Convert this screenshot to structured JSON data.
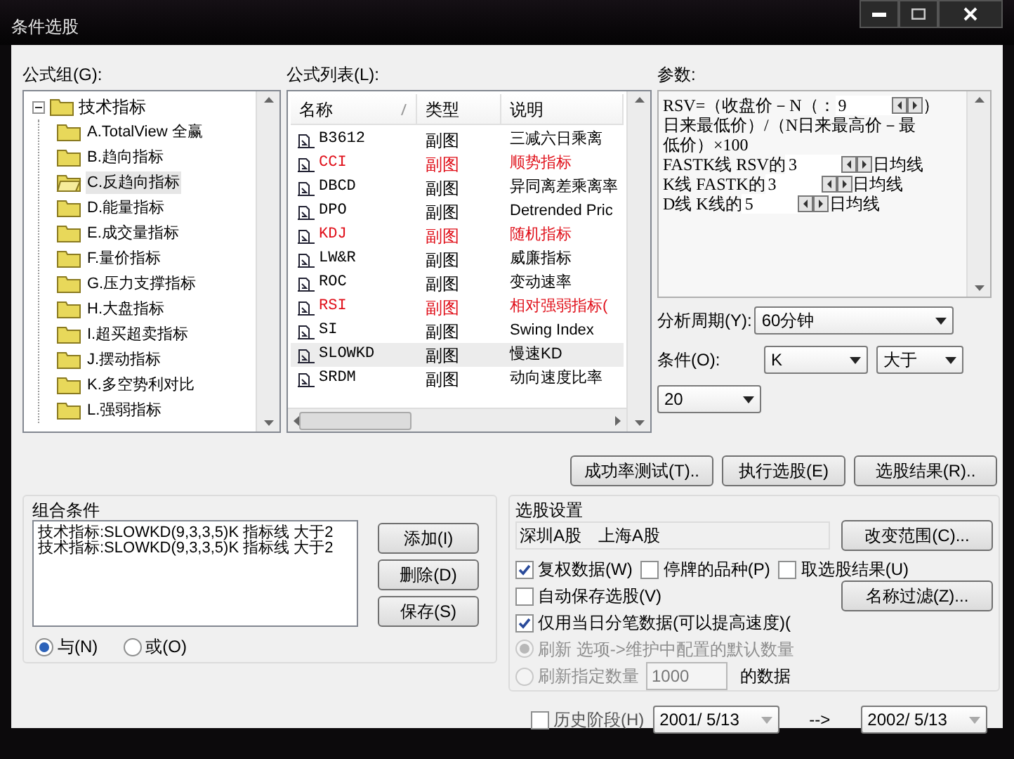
{
  "window": {
    "title": "条件选股"
  },
  "formula_group": {
    "label": "公式组(G):",
    "tree": {
      "label": "技术指标",
      "expanded": true,
      "children": [
        {
          "label": "A.TotalView 全赢",
          "selected": false
        },
        {
          "label": "B.趋向指标",
          "selected": false
        },
        {
          "label": "C.反趋向指标",
          "selected": true
        },
        {
          "label": "D.能量指标",
          "selected": false
        },
        {
          "label": "E.成交量指标",
          "selected": false
        },
        {
          "label": "F.量价指标",
          "selected": false
        },
        {
          "label": "G.压力支撑指标",
          "selected": false
        },
        {
          "label": "H.大盘指标",
          "selected": false
        },
        {
          "label": "I.超买超卖指标",
          "selected": false
        },
        {
          "label": "J.摆动指标",
          "selected": false
        },
        {
          "label": "K.多空势利对比",
          "selected": false
        },
        {
          "label": "L.强弱指标",
          "selected": false
        }
      ]
    }
  },
  "formula_list": {
    "label": "公式列表(L):",
    "columns": [
      "名称",
      "类型",
      "说明"
    ],
    "rows": [
      {
        "name": "B3612",
        "type": "副图",
        "desc": "三减六日乘离",
        "highlighted": false,
        "selected": false
      },
      {
        "name": "CCI",
        "type": "副图",
        "desc": "顺势指标",
        "highlighted": true,
        "selected": false
      },
      {
        "name": "DBCD",
        "type": "副图",
        "desc": "异同离差乘离率",
        "highlighted": false,
        "selected": false
      },
      {
        "name": "DPO",
        "type": "副图",
        "desc": "Detrended Pric",
        "highlighted": false,
        "selected": false
      },
      {
        "name": "KDJ",
        "type": "副图",
        "desc": "随机指标",
        "highlighted": true,
        "selected": false
      },
      {
        "name": "LW&R",
        "type": "副图",
        "desc": "威廉指标",
        "highlighted": false,
        "selected": false
      },
      {
        "name": "ROC",
        "type": "副图",
        "desc": "变动速率",
        "highlighted": false,
        "selected": false
      },
      {
        "name": "RSI",
        "type": "副图",
        "desc": "相对强弱指标(",
        "highlighted": true,
        "selected": false
      },
      {
        "name": "SI",
        "type": "副图",
        "desc": "Swing Index",
        "highlighted": false,
        "selected": false
      },
      {
        "name": "SLOWKD",
        "type": "副图",
        "desc": "慢速KD",
        "highlighted": false,
        "selected": true
      },
      {
        "name": "SRDM",
        "type": "副图",
        "desc": "动向速度比率",
        "highlighted": false,
        "selected": false
      }
    ]
  },
  "params": {
    "label": "参数:",
    "segments": [
      {
        "kind": "text",
        "text": "RSV=（收盘价－N（："
      },
      {
        "kind": "spin",
        "value": "9"
      },
      {
        "kind": "text",
        "text": "）"
      },
      {
        "kind": "break"
      },
      {
        "kind": "text",
        "text": "日来最低价）/（N日来最高价－最"
      },
      {
        "kind": "break"
      },
      {
        "kind": "text",
        "text": "低价）×100"
      },
      {
        "kind": "break"
      },
      {
        "kind": "text",
        "text": "FASTK线  RSV的"
      },
      {
        "kind": "spin",
        "value": "3"
      },
      {
        "kind": "text",
        "text": "日均线"
      },
      {
        "kind": "break"
      },
      {
        "kind": "text",
        "text": "K线  FASTK的"
      },
      {
        "kind": "spin",
        "value": "3"
      },
      {
        "kind": "text",
        "text": "日均线"
      },
      {
        "kind": "break"
      },
      {
        "kind": "text",
        "text": "D线  K线的"
      },
      {
        "kind": "spin",
        "value": "5"
      },
      {
        "kind": "text",
        "text": "日均线"
      }
    ]
  },
  "period": {
    "label": "分析周期(Y):",
    "value": "60分钟"
  },
  "condition": {
    "label": "条件(O):",
    "line": "K",
    "operator": "大于",
    "value": "20"
  },
  "actions": [
    "成功率测试(T)..",
    "执行选股(E)",
    "选股结果(R).."
  ],
  "combo": {
    "title": "组合条件",
    "items": [
      "技术指标:SLOWKD(9,3,3,5)K 指标线 大于2",
      "技术指标:SLOWKD(9,3,3,5)K 指标线 大于2"
    ],
    "buttons": [
      "添加(I)",
      "删除(D)",
      "保存(S)"
    ],
    "modes": [
      {
        "label": "与(N)",
        "selected": true
      },
      {
        "label": "或(O)",
        "selected": false
      }
    ]
  },
  "settings": {
    "title": "选股设置",
    "range": "深圳A股　上海A股",
    "range_button": "改变范围(C)...",
    "filter_button": "名称过滤(Z)...",
    "options": [
      {
        "label": "复权数据(W)",
        "checked": true
      },
      {
        "label": "停牌的品种(P)",
        "checked": false
      },
      {
        "label": "取选股结果(U)",
        "checked": false
      }
    ],
    "auto_save": {
      "label": "自动保存选股(V)",
      "checked": false
    },
    "tick_only": {
      "label": "仅用当日分笔数据(可以提高速度)(",
      "checked": true
    },
    "refresh": [
      {
        "label": "刷新 选项->维护中配置的默认数量",
        "selected": true,
        "disabled": true
      },
      {
        "label": "刷新指定数量",
        "selected": false,
        "disabled": true
      }
    ],
    "count": "1000",
    "count_suffix": "的数据"
  },
  "history": {
    "label": "历史阶段(H)",
    "checked": false,
    "from": "2001/ 5/13",
    "arrow": "-->",
    "to": "2002/ 5/13"
  }
}
